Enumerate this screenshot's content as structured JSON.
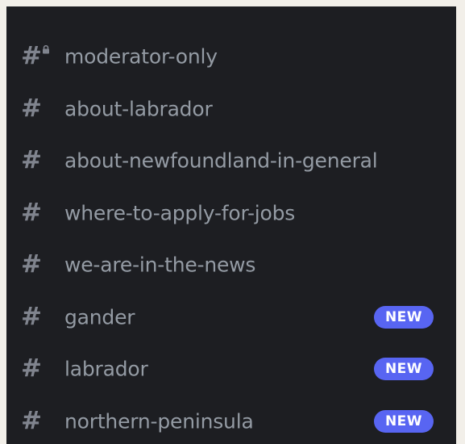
{
  "channels": [
    {
      "hash": "#",
      "name": "moderator-only",
      "locked": true,
      "badge": ""
    },
    {
      "hash": "#",
      "name": "about-labrador",
      "locked": false,
      "badge": ""
    },
    {
      "hash": "#",
      "name": "about-newfoundland-in-general",
      "locked": false,
      "badge": ""
    },
    {
      "hash": "#",
      "name": "where-to-apply-for-jobs",
      "locked": false,
      "badge": ""
    },
    {
      "hash": "#",
      "name": "we-are-in-the-news",
      "locked": false,
      "badge": ""
    },
    {
      "hash": "#",
      "name": "gander",
      "locked": false,
      "badge": "NEW"
    },
    {
      "hash": "#",
      "name": "labrador",
      "locked": false,
      "badge": "NEW"
    },
    {
      "hash": "#",
      "name": "northern-peninsula",
      "locked": false,
      "badge": "NEW"
    }
  ],
  "colors": {
    "background": "#1d1e22",
    "channel_text": "#949ba4",
    "hash_icon": "#80848e",
    "badge_bg": "#5865f2",
    "badge_text": "#ffffff",
    "outer_frame": "#f2efe9"
  }
}
